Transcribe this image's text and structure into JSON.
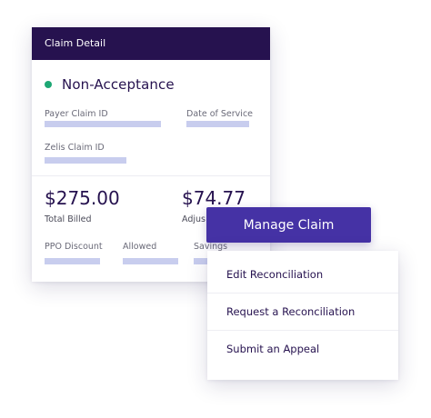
{
  "card": {
    "header_title": "Claim Detail",
    "status": {
      "label": "Non-Acceptance",
      "color": "#1ea774"
    },
    "fields": {
      "payer_claim_id": "Payer Claim ID",
      "date_of_service": "Date of Service",
      "zelis_claim_id": "Zelis Claim ID"
    },
    "totals": {
      "total_billed_value": "$275.00",
      "total_billed_label": "Total Billed",
      "adjusted_value": "$74.77",
      "adjusted_label": "Adjus"
    },
    "breakdown": {
      "ppo_discount": "PPO Discount",
      "allowed": "Allowed",
      "savings": "Savings"
    }
  },
  "manage_button": {
    "label": "Manage Claim"
  },
  "menu": {
    "items": [
      "Edit Reconciliation",
      "Request a Reconciliation",
      "Submit an Appeal"
    ]
  },
  "colors": {
    "header_bg": "#26124f",
    "accent": "#4532a5",
    "placeholder_bar": "#c8cdee",
    "text_dark": "#26124f"
  }
}
